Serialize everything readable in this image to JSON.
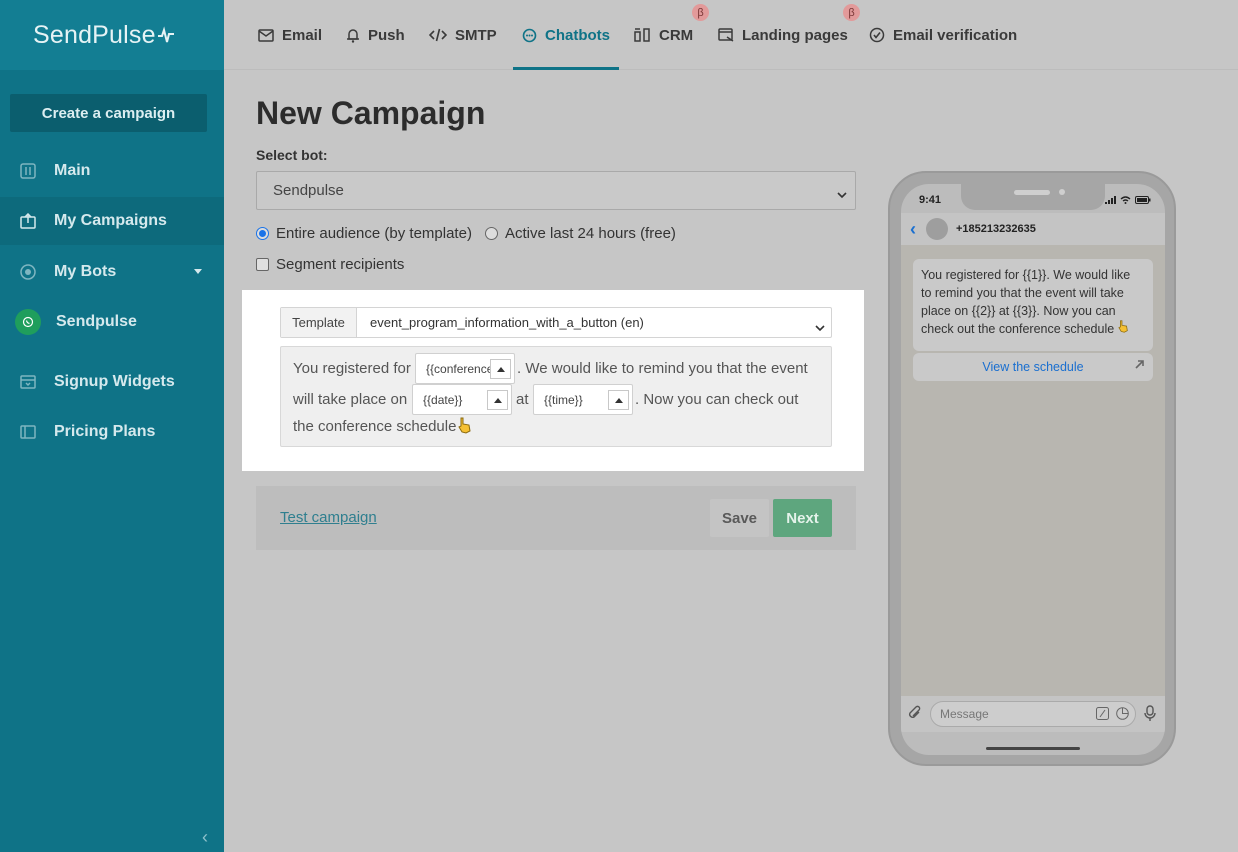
{
  "sidebar": {
    "logo": "SendPulse",
    "create_button": "Create a campaign",
    "items": [
      {
        "label": "Main"
      },
      {
        "label": "My Campaigns"
      },
      {
        "label": "My Bots"
      },
      {
        "label": "Sendpulse"
      },
      {
        "label": "Signup Widgets"
      },
      {
        "label": "Pricing Plans"
      }
    ]
  },
  "topnav": {
    "items": [
      {
        "label": "Email"
      },
      {
        "label": "Push"
      },
      {
        "label": "SMTP"
      },
      {
        "label": "Chatbots"
      },
      {
        "label": "CRM"
      },
      {
        "label": "Landing pages"
      },
      {
        "label": "Email verification"
      }
    ],
    "beta_symbol": "β"
  },
  "page": {
    "title": "New Campaign",
    "select_bot_label": "Select bot:",
    "bot_value": "Sendpulse",
    "audience_option_1": "Entire audience (by template)",
    "audience_option_2": "Active last 24 hours (free)",
    "segment_label": "Segment recipients"
  },
  "template": {
    "label": "Template",
    "value": "event_program_information_with_a_button (en)",
    "text_1": "You registered for",
    "var_1": "{{conference}}",
    "text_2": ". We would like to remind you that the event",
    "text_3": "will take place on",
    "var_2": "{{date}}",
    "text_4": "at",
    "var_3": "{{time}}",
    "text_5": ". Now you can check out",
    "text_6": "the conference schedule"
  },
  "footer": {
    "test_link": "Test campaign",
    "save": "Save",
    "next": "Next"
  },
  "phone": {
    "time": "9:41",
    "contact": "+185213232635",
    "message_line_1": "You registered for {{1}}. We would like",
    "message_line_2": "to remind you that the event will take",
    "message_line_3": "place on {{2}} at {{3}}. Now you can",
    "message_line_4": "check out the conference schedule",
    "button_label": "View the schedule",
    "input_placeholder": "Message"
  },
  "colors": {
    "sidebar": "#0f7387",
    "accent": "#0f7387",
    "next_button": "#5ea67e",
    "link": "#1a6fd0"
  }
}
